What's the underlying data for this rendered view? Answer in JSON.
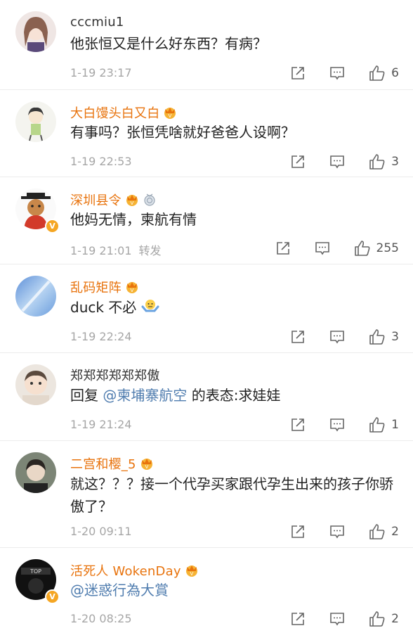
{
  "comments": [
    {
      "name": "cccmiu1",
      "style": "plain",
      "text": "他张恒又是什么好东西？有病？",
      "time": "1-19 23:17",
      "likes": "6"
    },
    {
      "name": "大白馒头白又白",
      "style": "vip",
      "text": "有事吗？张恒凭啥就好爸爸人设啊？",
      "time": "1-19 22:53",
      "likes": "3"
    },
    {
      "name": "深圳县令",
      "style": "vip",
      "text": "他妈无情，柬航有情",
      "time": "1-19 21:01",
      "extra": "转发",
      "likes": "255"
    },
    {
      "name": "乱码矩阵",
      "style": "vip",
      "text": "duck 不必",
      "time": "1-19 22:24",
      "likes": "3"
    },
    {
      "name": "郑郑郑郑郑郑傲",
      "style": "plain",
      "text_prefix": "回复",
      "mention": "@柬埔寨航空",
      "text_suffix": " 的表态:求娃娃",
      "time": "1-19 21:24",
      "likes": "1"
    },
    {
      "name": "二宫和樱_5",
      "style": "vip",
      "text": "就这？？？接一个代孕买家跟代孕生出来的孩子你骄傲了？",
      "time": "1-20 09:11",
      "likes": "2"
    },
    {
      "name": "活死人 WokenDay",
      "style": "vip",
      "mention": "@迷惑行為大賞",
      "time": "1-20 08:25",
      "likes": "2"
    }
  ],
  "icons": {
    "repost": "repost-icon",
    "comment": "comment-icon",
    "like": "like-icon",
    "vip": "vip-crown-icon",
    "verified": "verified-v-icon",
    "emoji": "shrug-emoji-icon",
    "level": "level-medal-icon"
  },
  "colors": {
    "vip_name": "#e8730d",
    "mention": "#507daf",
    "meta": "#a6a6a6",
    "badge": "#f5a623"
  }
}
